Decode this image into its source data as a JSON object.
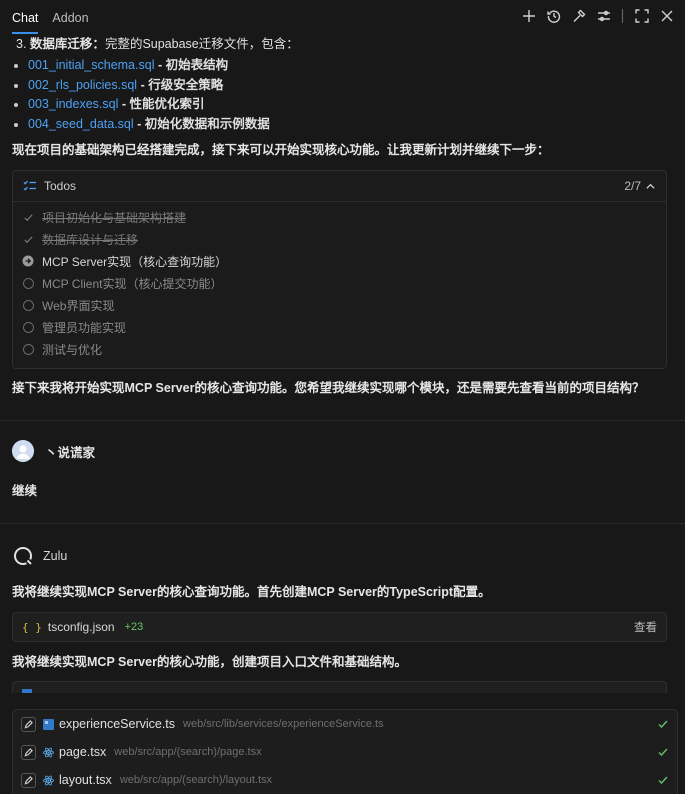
{
  "header": {
    "tabs": [
      {
        "label": "Chat",
        "active": true
      },
      {
        "label": "Addon",
        "active": false
      }
    ],
    "icons": [
      "plus-icon",
      "history-icon",
      "hammer-icon",
      "settings-sliders-icon",
      "expand-icon",
      "close-icon"
    ]
  },
  "message_top": {
    "migration_heading_num": "3.",
    "migration_heading_bold": "数据库迁移：",
    "migration_heading_rest": "完整的Supabase迁移文件，包含：",
    "files": [
      {
        "name": "001_initial_schema.sql",
        "desc": " - 初始表结构"
      },
      {
        "name": "002_rls_policies.sql",
        "desc": " - 行级安全策略"
      },
      {
        "name": "003_indexes.sql",
        "desc": " - 性能优化索引"
      },
      {
        "name": "004_seed_data.sql",
        "desc": " - 初始化数据和示例数据"
      }
    ],
    "summary": "现在项目的基础架构已经搭建完成，接下来可以开始实现核心功能。让我更新计划并继续下一步："
  },
  "todos": {
    "title": "Todos",
    "count": "2/7",
    "items": [
      {
        "label": "项目初始化与基础架构搭建",
        "status": "done"
      },
      {
        "label": "数据库设计与迁移",
        "status": "done"
      },
      {
        "label": "MCP Server实现（核心查询功能）",
        "status": "current"
      },
      {
        "label": "MCP Client实现（核心提交功能）",
        "status": "pending"
      },
      {
        "label": "Web界面实现",
        "status": "pending"
      },
      {
        "label": "管理员功能实现",
        "status": "pending"
      },
      {
        "label": "测试与优化",
        "status": "pending"
      }
    ]
  },
  "question": "接下来我将开始实现MCP Server的核心查询功能。您希望我继续实现哪个模块，还是需要先查看当前的项目结构？",
  "user": {
    "name": "丶说谎家",
    "message": "继续"
  },
  "assistant": {
    "name": "Zulu",
    "msg1": "我将继续实现MCP Server的核心查询功能。首先创建MCP Server的TypeScript配置。",
    "file": {
      "icon": "{ }",
      "name": "tsconfig.json",
      "added": "+23",
      "action": "查看"
    },
    "msg2": "我将继续实现MCP Server的核心功能，创建项目入口文件和基础结构。"
  },
  "changes_panel": {
    "rows": [
      {
        "name": "experienceService.ts",
        "path": "web/src/lib/services/experienceService.ts",
        "icon": "typescript-icon"
      },
      {
        "name": "page.tsx",
        "path": "web/src/app/(search)/page.tsx",
        "icon": "react-icon"
      },
      {
        "name": "layout.tsx",
        "path": "web/src/app/(search)/layout.tsx",
        "icon": "react-icon"
      }
    ]
  },
  "colors": {
    "background": "#181818",
    "link": "#4ea1f3",
    "accent": "#3b8eea",
    "success": "#6bc46b",
    "brace": "#e2b54a"
  }
}
